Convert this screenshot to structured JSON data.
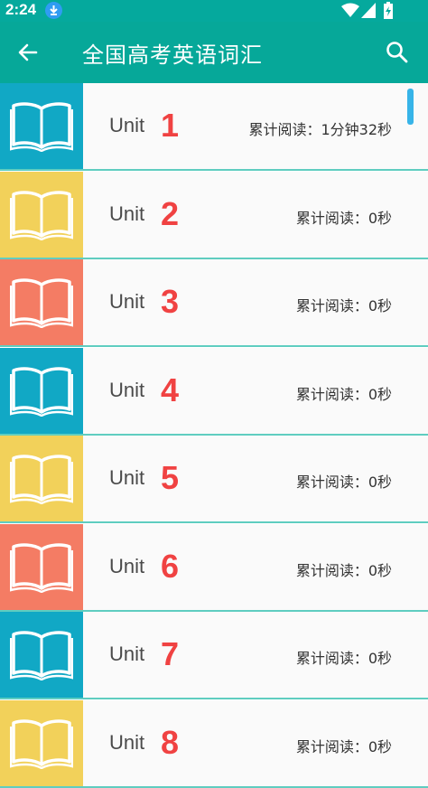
{
  "status_bar": {
    "time": "2:24"
  },
  "app_bar": {
    "title": "全国高考英语词汇"
  },
  "colors": {
    "teal": "#05a99d",
    "blue": "#11a8c5",
    "yellow": "#f2d15a",
    "salmon": "#f47c64",
    "number_red": "#f04242"
  },
  "units": [
    {
      "unit_label": "Unit",
      "number": "1",
      "read": "累计阅读：1分钟32秒",
      "color": "#11a8c5"
    },
    {
      "unit_label": "Unit",
      "number": "2",
      "read": "累计阅读：0秒",
      "color": "#f2d15a"
    },
    {
      "unit_label": "Unit",
      "number": "3",
      "read": "累计阅读：0秒",
      "color": "#f47c64"
    },
    {
      "unit_label": "Unit",
      "number": "4",
      "read": "累计阅读：0秒",
      "color": "#11a8c5"
    },
    {
      "unit_label": "Unit",
      "number": "5",
      "read": "累计阅读：0秒",
      "color": "#f2d15a"
    },
    {
      "unit_label": "Unit",
      "number": "6",
      "read": "累计阅读：0秒",
      "color": "#f47c64"
    },
    {
      "unit_label": "Unit",
      "number": "7",
      "read": "累计阅读：0秒",
      "color": "#11a8c5"
    },
    {
      "unit_label": "Unit",
      "number": "8",
      "read": "累计阅读：0秒",
      "color": "#f2d15a"
    }
  ]
}
